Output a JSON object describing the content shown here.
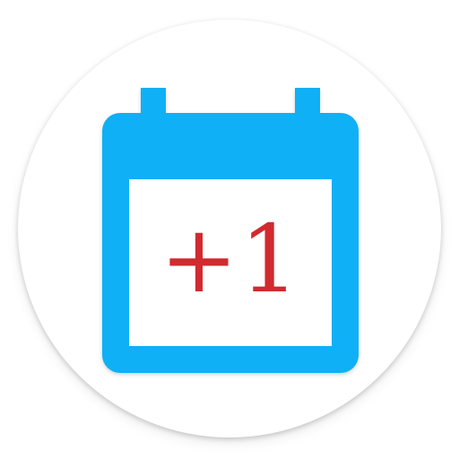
{
  "app_icon": {
    "name": "calendar-plus-one",
    "mark_text": "+1",
    "colors": {
      "calendar": "#0fb0f5",
      "mark": "#d12a2f",
      "background": "#ffffff"
    }
  }
}
